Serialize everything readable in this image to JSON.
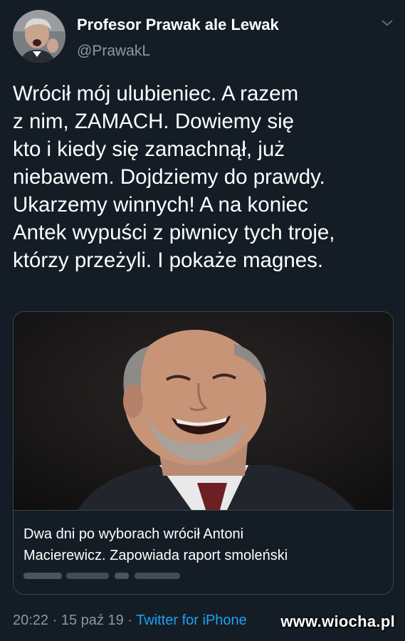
{
  "author": {
    "display_name": "Profesor Prawak ale Lewak",
    "handle": "@PrawakL",
    "avatar_icon": "user-avatar"
  },
  "tweet": {
    "text": "Wrócił mój ulubieniec. A razem\nz nim, ZAMACH. Dowiemy się\nkto i kiedy się zamachnął, już\nniebawem. Dojdziemy do prawdy.\nUkarzemy winnych! A na koniec\nAntek wypuści z piwnicy tych troje,\nktórzy przeżyli. I pokaże magnes."
  },
  "card": {
    "title": "Dwa dni po wyborach wrócił Antoni\nMacierewicz. Zapowiada raport smoleński",
    "image_icon": "laughing-man-photo"
  },
  "meta": {
    "time": "20:22",
    "separator": "·",
    "date": "15 paź 19",
    "source": "Twitter for iPhone"
  },
  "watermark": "www.wiocha.pl",
  "colors": {
    "background": "#141d26",
    "secondary_text": "#8899a6",
    "link": "#1da1f2",
    "border": "#38444d"
  }
}
